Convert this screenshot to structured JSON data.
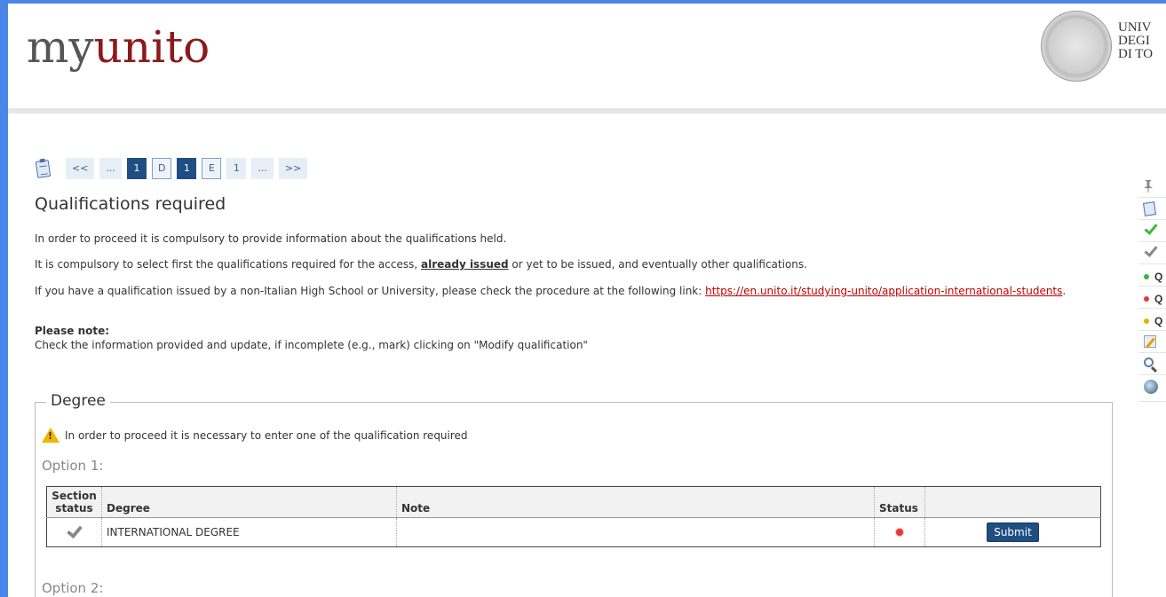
{
  "header": {
    "logo_prefix": "my",
    "logo_suffix": "unito",
    "university_lines": [
      "UNIV",
      "DEGI",
      "DI TO"
    ]
  },
  "pager": {
    "items": [
      "<<",
      "...",
      "1",
      "D",
      "1",
      "E",
      "1",
      "...",
      ">>"
    ]
  },
  "page": {
    "title": "Qualifications required",
    "para1": "In order to proceed it is compulsory to provide information about the qualifications held.",
    "para2_before": "It is compulsory to select first the qualifications required for the access, ",
    "para2_bold": "already issued",
    "para2_after": " or yet to be issued, and eventually other qualifications.",
    "para3_before": "If you have a qualification issued by a non-Italian High School or University, please check the procedure at the following link: ",
    "para3_link": "https://en.unito.it/studying-unito/application-international-students",
    "para3_after": ".",
    "note_label": "Please note:",
    "note_text": "Check the information provided and update, if incomplete (e.g., mark) clicking on \"Modify qualification\""
  },
  "degree": {
    "legend": "Degree",
    "warning": "In order to proceed it is necessary to enter one of the qualification required",
    "option1": "Option 1:",
    "option2": "Option 2:",
    "table": {
      "headers": [
        "Section status",
        "Degree",
        "Note",
        "Status",
        ""
      ],
      "rows": [
        {
          "degree": "INTERNATIONAL DEGREE",
          "note": "",
          "status_color": "#e53935",
          "action": "Submit"
        }
      ]
    }
  },
  "sidebar": {
    "icons": [
      "pin-icon",
      "clipboard-icon",
      "green-check-icon",
      "grey-check-icon",
      "green-dot-icon",
      "red-dot-icon",
      "yellow-dot-icon",
      "edit-icon",
      "search-icon",
      "globe-icon"
    ],
    "dot_labels": [
      "Q",
      "Q",
      "Q"
    ],
    "colors": {
      "green": "#3db53d",
      "red": "#e53935",
      "yellow": "#e0b400",
      "grey": "#888888"
    }
  }
}
